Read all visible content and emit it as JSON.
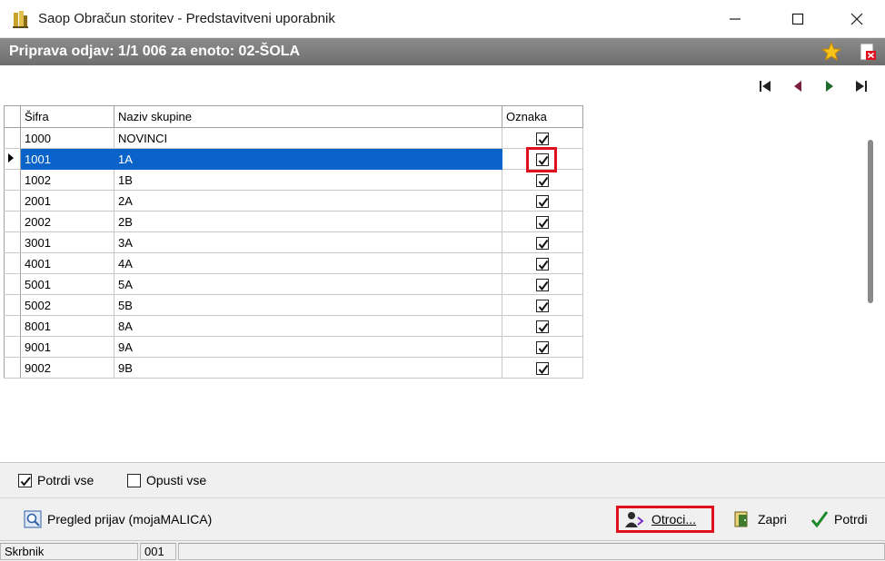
{
  "window": {
    "title": "Saop Obračun storitev - Predstavitveni uporabnik"
  },
  "header": {
    "title": "Priprava odjav: 1/1 006 za enoto: 02-ŠOLA"
  },
  "table": {
    "columns": [
      "Šifra",
      "Naziv skupine",
      "Oznaka"
    ],
    "rows": [
      {
        "sifra": "1000",
        "naziv": "NOVINCI",
        "checked": true
      },
      {
        "sifra": "1001",
        "naziv": "1A",
        "checked": true
      },
      {
        "sifra": "1002",
        "naziv": "1B",
        "checked": true
      },
      {
        "sifra": "2001",
        "naziv": "2A",
        "checked": true
      },
      {
        "sifra": "2002",
        "naziv": "2B",
        "checked": true
      },
      {
        "sifra": "3001",
        "naziv": "3A",
        "checked": true
      },
      {
        "sifra": "4001",
        "naziv": "4A",
        "checked": true
      },
      {
        "sifra": "5001",
        "naziv": "5A",
        "checked": true
      },
      {
        "sifra": "5002",
        "naziv": "5B",
        "checked": true
      },
      {
        "sifra": "8001",
        "naziv": "8A",
        "checked": true
      },
      {
        "sifra": "9001",
        "naziv": "9A",
        "checked": true
      },
      {
        "sifra": "9002",
        "naziv": "9B",
        "checked": true
      }
    ],
    "selected_row": 1
  },
  "options": {
    "potrdi_vse": {
      "label": "Potrdi vse",
      "checked": true
    },
    "opusti_vse": {
      "label": "Opusti vse",
      "checked": false
    }
  },
  "buttons": {
    "pregled": "Pregled prijav (mojaMALICA)",
    "otroci": "Otroci...",
    "zapri": "Zapri",
    "potrdi": "Potrdi"
  },
  "status": {
    "field1": "Skrbnik",
    "field2": "001",
    "field3": ""
  },
  "colors": {
    "selection": "#0a63c9",
    "highlight": "#e0101e",
    "header_bar": "#7d7d7d"
  }
}
